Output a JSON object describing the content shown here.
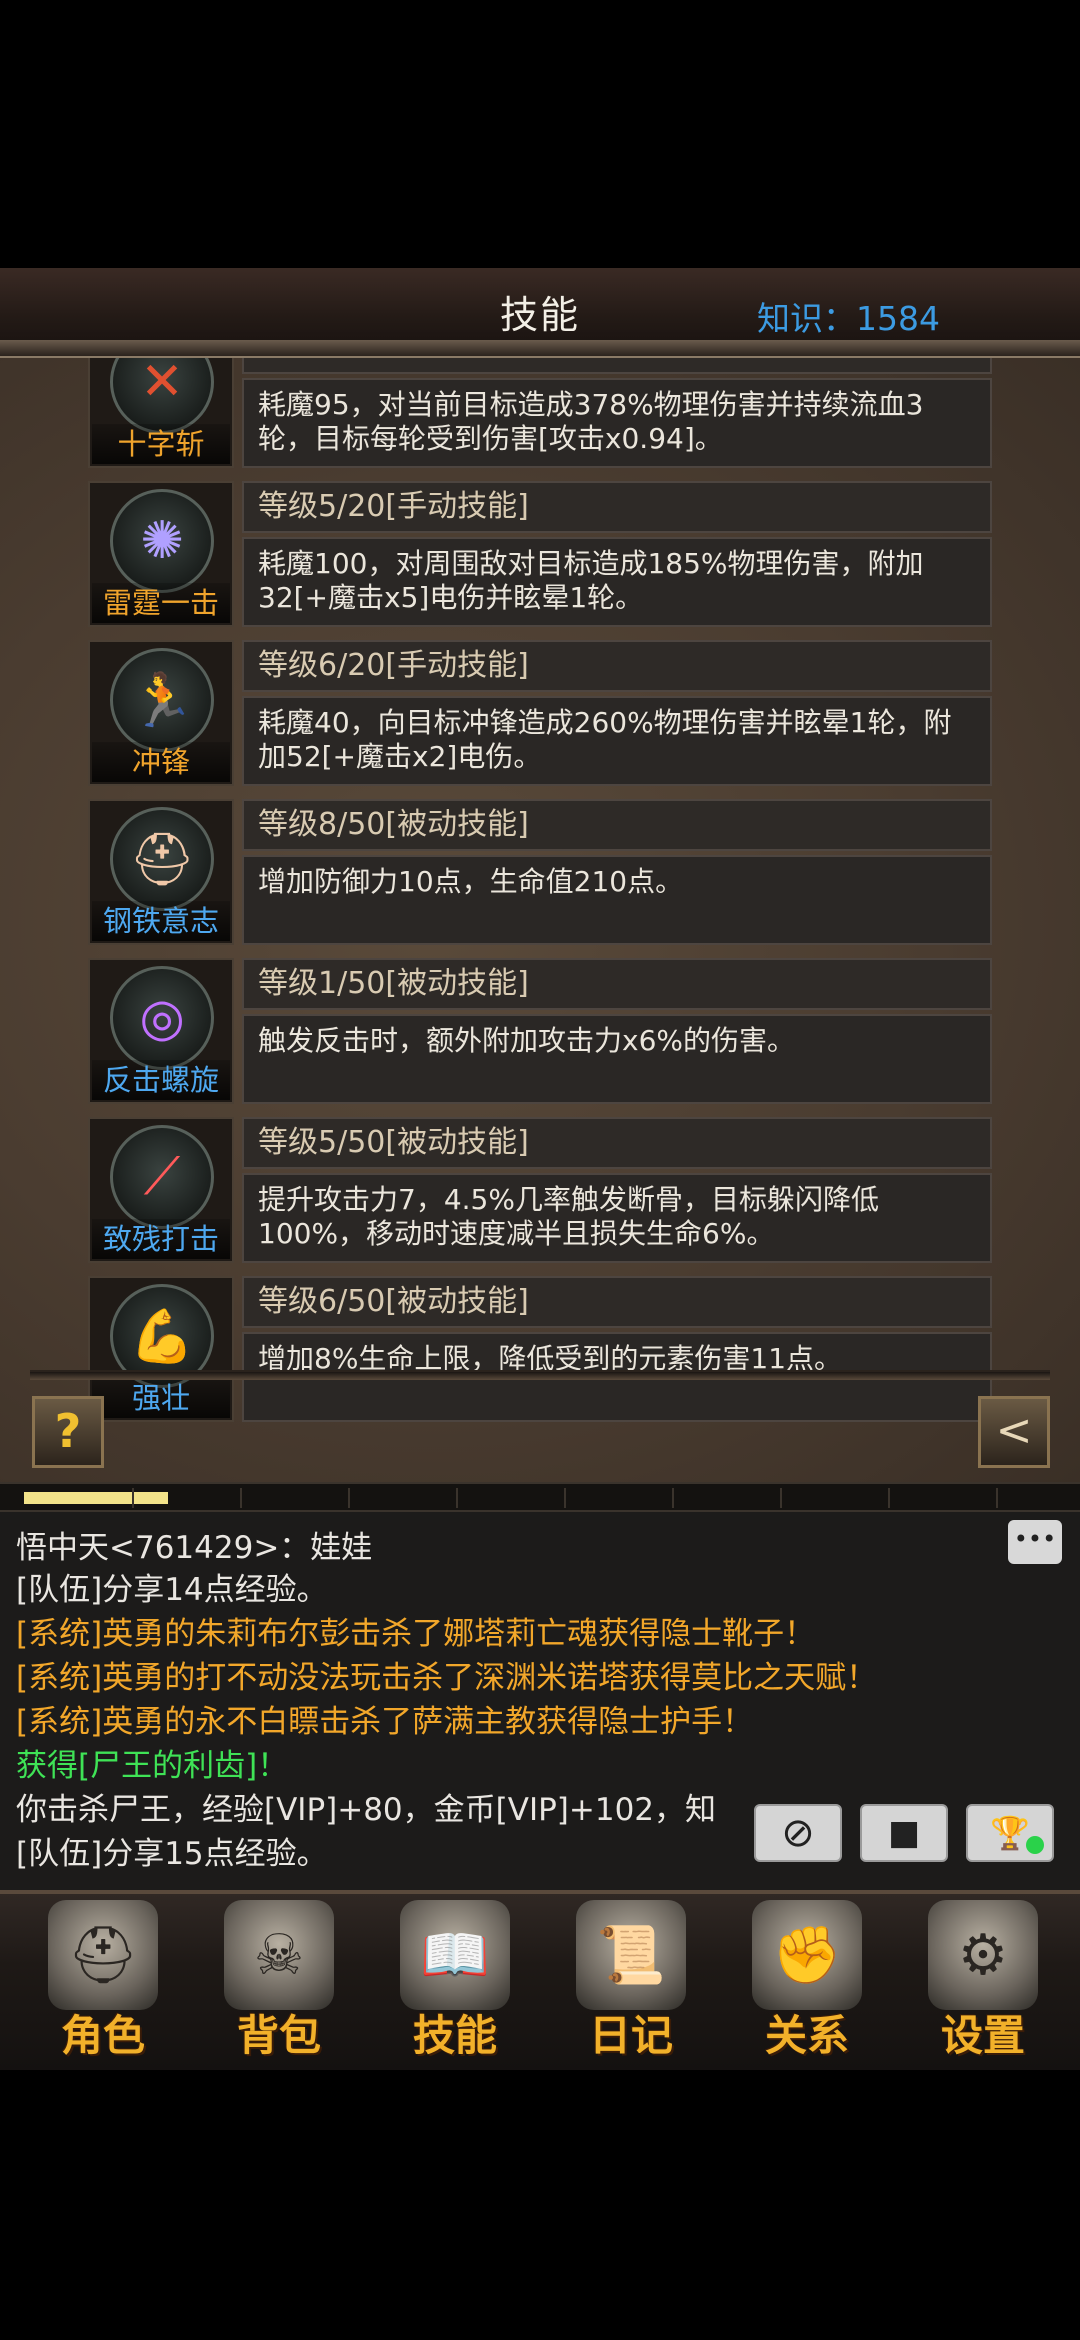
{
  "header": {
    "title": "技能",
    "knowledge_label": "知识：",
    "knowledge_value": "1584"
  },
  "skills": [
    {
      "name": "十字斩",
      "name_color": "gold",
      "icon": "cross-slash-icon",
      "level": "",
      "desc": "耗魔95，对当前目标造成378%物理伤害并持续流血3轮，目标每轮受到伤害[攻击x0.94]。"
    },
    {
      "name": "雷霆一击",
      "name_color": "gold",
      "icon": "thunder-strike-icon",
      "level": "等级5/20[手动技能]",
      "desc": "耗魔100，对周围敌对目标造成185%物理伤害，附加32[+魔击x5]电伤并眩晕1轮。"
    },
    {
      "name": "冲锋",
      "name_color": "gold",
      "icon": "charge-icon",
      "level": "等级6/20[手动技能]",
      "desc": "耗魔40，向目标冲锋造成260%物理伤害并眩晕1轮，附加52[+魔击x2]电伤。"
    },
    {
      "name": "钢铁意志",
      "name_color": "blue",
      "icon": "helmet-icon",
      "level": "等级8/50[被动技能]",
      "desc": "增加防御力10点，生命值210点。"
    },
    {
      "name": "反击螺旋",
      "name_color": "blue",
      "icon": "spiral-icon",
      "level": "等级1/50[被动技能]",
      "desc": "触发反击时，额外附加攻击力x6%的伤害。"
    },
    {
      "name": "致残打击",
      "name_color": "blue",
      "icon": "crippling-strike-icon",
      "level": "等级5/50[被动技能]",
      "desc": "提升攻击力7，4.5%几率触发断骨，目标躲闪降低100%，移动时速度减半且损失生命6%。"
    },
    {
      "name": "强壮",
      "name_color": "blue",
      "icon": "strong-man-icon",
      "level": "等级6/50[被动技能]",
      "desc": "增加8%生命上限，降低受到的元素伤害11点。"
    }
  ],
  "panel": {
    "help_label": "?",
    "back_label": "<"
  },
  "exp_bar": {
    "fill_fraction": 0.14
  },
  "chat": {
    "lines": [
      {
        "text": "悟中天<761429>：娃娃",
        "color": "white"
      },
      {
        "text": "[队伍]分享14点经验。",
        "color": "white"
      },
      {
        "text": "[系统]英勇的朱莉布尔彭击杀了娜塔莉亡魂获得隐士靴子！",
        "color": "orange"
      },
      {
        "text": "[系统]英勇的打不动没法玩击杀了深渊米诺塔获得莫比之天赋！",
        "color": "orange"
      },
      {
        "text": "[系统]英勇的永不白瞟击杀了萨满主教获得隐士护手！",
        "color": "orange"
      },
      {
        "text": "获得[尸王的利齿]！",
        "color": "green"
      },
      {
        "text": "你击杀尸王，经验[VIP]+80，金币[VIP]+102，知",
        "color": "white"
      },
      {
        "text": "[队伍]分享15点经验。",
        "color": "white"
      }
    ],
    "bubble_icon": "chat-bubble-icon"
  },
  "chat_buttons": [
    {
      "name": "compass-button",
      "icon": "compass-icon",
      "glyph": "⊘"
    },
    {
      "name": "stop-button",
      "icon": "square-icon",
      "glyph": "■"
    },
    {
      "name": "trophy-button",
      "icon": "trophy-icon",
      "glyph": "🏆"
    }
  ],
  "nav": [
    {
      "label": "角色",
      "icon": "knight-helmet-icon",
      "glyph": "⛑"
    },
    {
      "label": "背包",
      "icon": "backpack-icon",
      "glyph": "☠"
    },
    {
      "label": "技能",
      "icon": "skill-book-icon",
      "glyph": "📖"
    },
    {
      "label": "日记",
      "icon": "scroll-icon",
      "glyph": "📜"
    },
    {
      "label": "关系",
      "icon": "gauntlet-icon",
      "glyph": "✊"
    },
    {
      "label": "设置",
      "icon": "gear-icon",
      "glyph": "⚙"
    }
  ]
}
